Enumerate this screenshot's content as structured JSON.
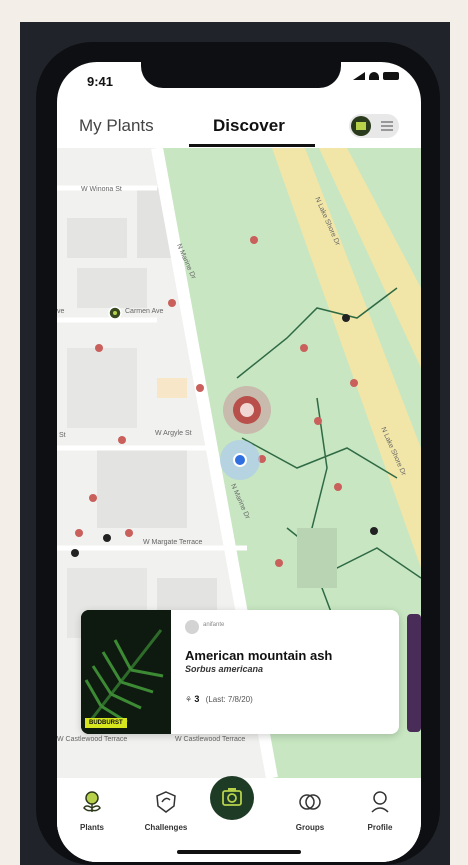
{
  "status": {
    "time": "9:41"
  },
  "tabs": {
    "my_plants": "My Plants",
    "discover": "Discover"
  },
  "map": {
    "streets": {
      "w_winona": "W Winona St",
      "n_marine_top": "N Marine Dr",
      "carmen": "Carmen Ave",
      "ave": "ve",
      "w_argyle": "W Argyle St",
      "st": "St",
      "n_marine_bottom": "N Marine Dr",
      "margate": "W Margate Terrace",
      "castlewood_1": "W Castlewood Terrace",
      "castlewood_2": "W Castlewood Terrace",
      "lake_shore_1": "N Lake Shore Dr",
      "lake_shore_2": "N Lake Shore Dr"
    }
  },
  "card": {
    "username": "anifante",
    "common_name": "American mountain ash",
    "scientific_name": "Sorbus americana",
    "observations": "3",
    "last": "(Last: 7/8/20)",
    "badge": "BUDBURST"
  },
  "nav": {
    "plants": "Plants",
    "challenges": "Challenges",
    "groups": "Groups",
    "profile": "Profile"
  },
  "colors": {
    "park_green": "#c7e6c1",
    "dark_green": "#1e3b26",
    "accent_lime": "#d7e51f",
    "marker_red": "#c9605b"
  }
}
